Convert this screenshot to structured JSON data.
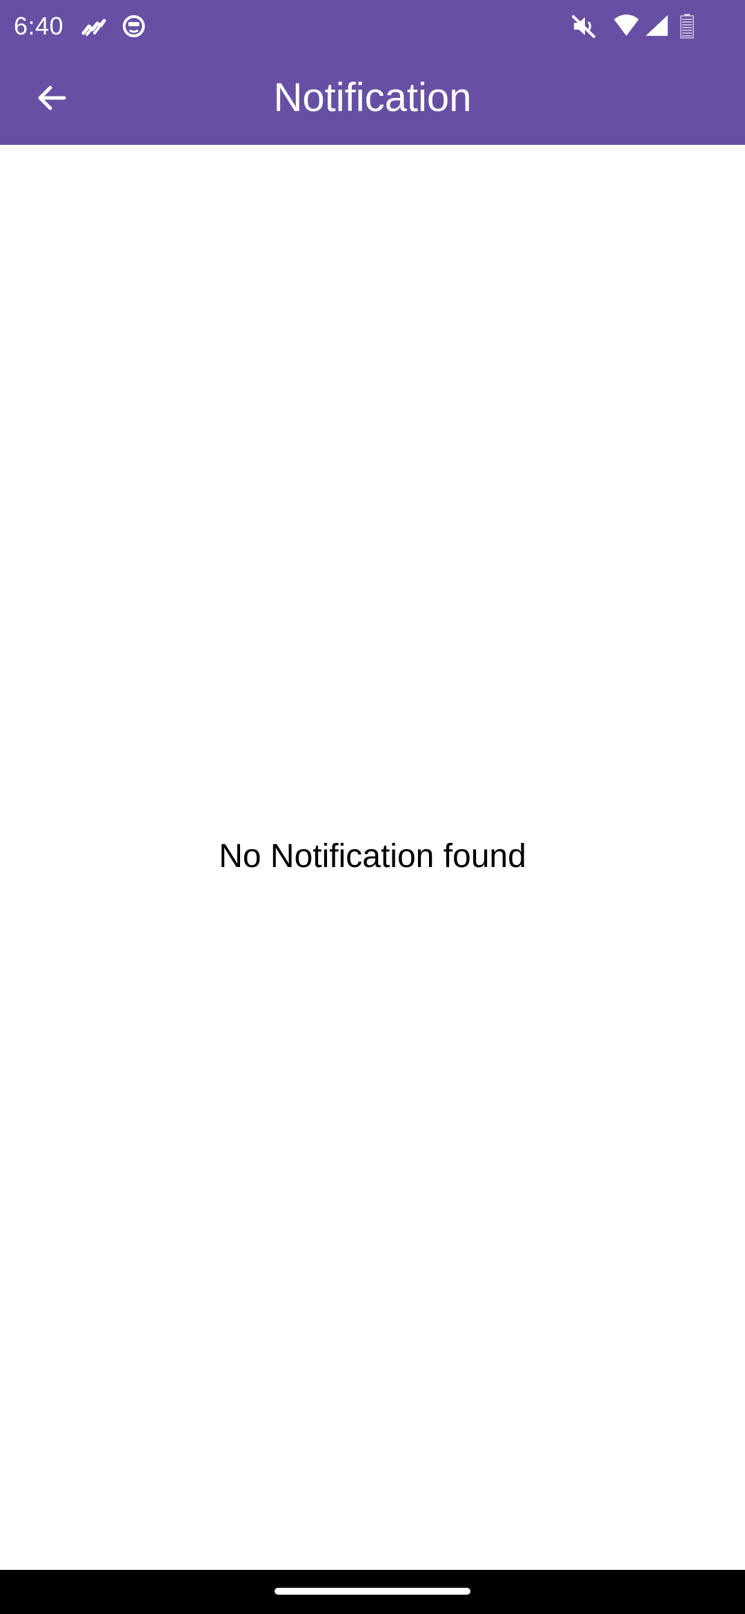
{
  "status_bar": {
    "time": "6:40",
    "icons": [
      "stocks-icon",
      "cat-face-icon",
      "mute-icon",
      "wifi-icon",
      "signal-icon",
      "battery-icon"
    ]
  },
  "app_bar": {
    "back_icon": "arrow-left-icon",
    "title": "Notification"
  },
  "content": {
    "empty_message": "No Notification found"
  },
  "colors": {
    "primary": "#6750a4",
    "background": "#ffffff",
    "text": "#000000",
    "on_primary": "#ffffff",
    "nav_bar": "#000000"
  }
}
